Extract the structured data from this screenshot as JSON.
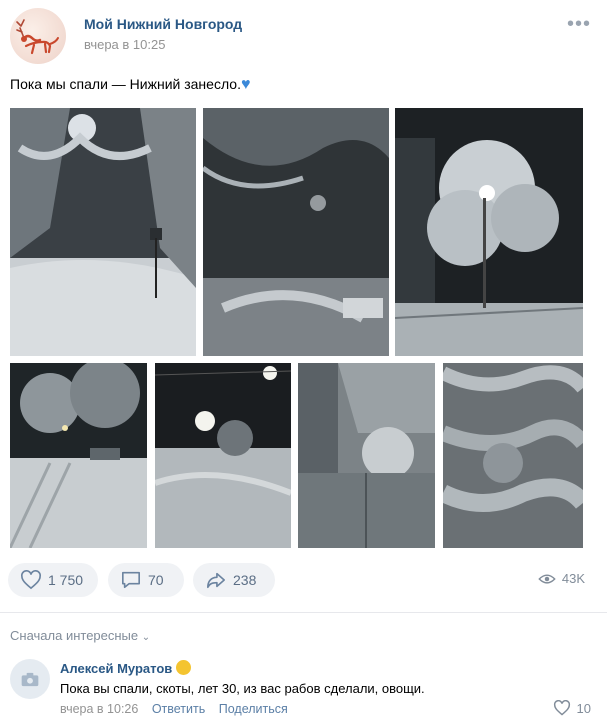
{
  "post": {
    "group_name": "Мой Нижний Новгород",
    "time": "вчера в 10:25",
    "text": "Пока мы спали — Нижний занесло.",
    "heart_icon": "blue-heart-icon"
  },
  "actions": {
    "likes": "1 750",
    "comments": "70",
    "shares": "238",
    "views": "43K"
  },
  "comments": {
    "sort_label": "Сначала интересные",
    "items": [
      {
        "author": "Алексей Муратов",
        "text": "Пока вы спали, скоты, лет 30, из вас рабов сделали, овощи.",
        "time": "вчера в 10:26",
        "reply": "Ответить",
        "share": "Поделиться",
        "likes": "10"
      }
    ]
  },
  "colors": {
    "link": "#2a5885",
    "action_bg": "#f0f2f5",
    "heart": "#3b89d9"
  }
}
